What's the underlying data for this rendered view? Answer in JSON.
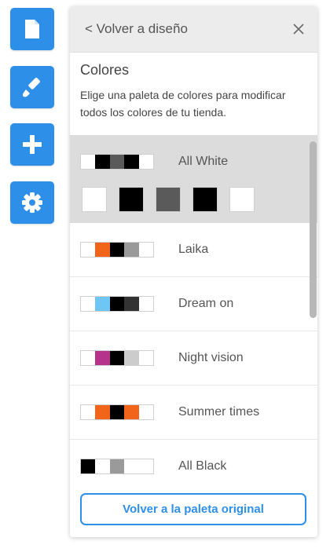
{
  "toolbar": {
    "buttons": [
      {
        "name": "pages",
        "icon": "document-icon"
      },
      {
        "name": "design",
        "icon": "brush-icon"
      },
      {
        "name": "add",
        "icon": "plus-icon"
      },
      {
        "name": "settings",
        "icon": "gear-icon"
      }
    ],
    "color": "#2e8fe8"
  },
  "panel": {
    "back_label": "< Volver a diseño",
    "close_icon": "close-icon",
    "section_title": "Colores",
    "section_description": "Elige una paleta de colores para modificar todos los colores de tu tienda.",
    "reset_button_label": "Volver a la paleta original"
  },
  "palettes": [
    {
      "name": "All White",
      "colors": [
        "#ffffff",
        "#000000",
        "#5a5a5a",
        "#000000",
        "#ffffff"
      ],
      "selected": true
    },
    {
      "name": "Laika",
      "colors": [
        "#ffffff",
        "#f26419",
        "#000000",
        "#9a9a9a",
        "#ffffff"
      ],
      "selected": false
    },
    {
      "name": "Dream on",
      "colors": [
        "#ffffff",
        "#6ec6f5",
        "#000000",
        "#333333",
        "#ffffff"
      ],
      "selected": false
    },
    {
      "name": "Night vision",
      "colors": [
        "#ffffff",
        "#b5338a",
        "#000000",
        "#cccccc",
        "#ffffff"
      ],
      "selected": false
    },
    {
      "name": "Summer times",
      "colors": [
        "#ffffff",
        "#f26419",
        "#000000",
        "#f26419",
        "#ffffff"
      ],
      "selected": false
    },
    {
      "name": "All Black",
      "colors": [
        "#000000",
        "#ffffff",
        "#9a9a9a",
        "#ffffff",
        "#ffffff"
      ],
      "selected": false
    }
  ]
}
